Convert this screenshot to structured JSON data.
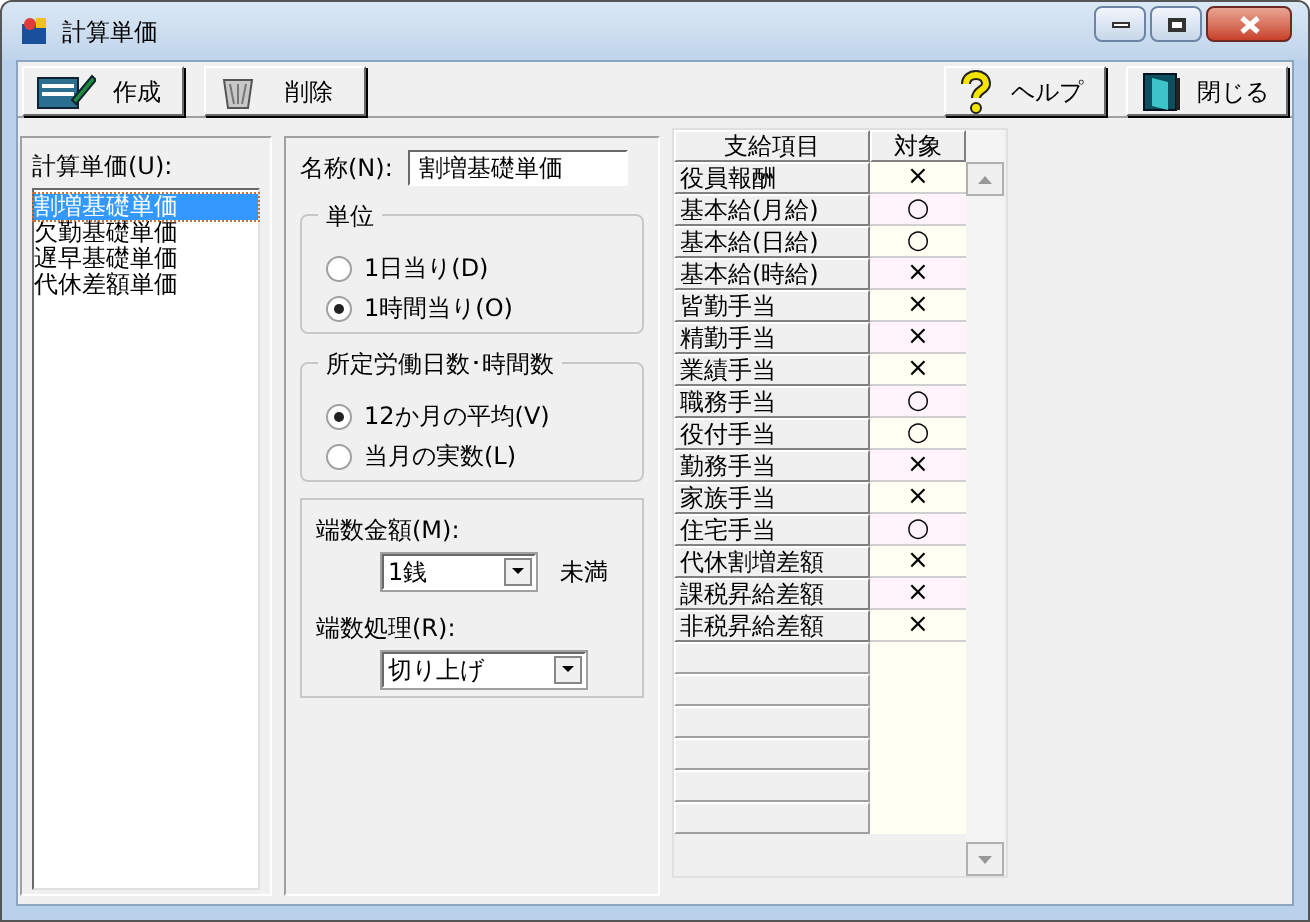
{
  "window": {
    "title": "計算単価"
  },
  "toolbar": {
    "left": [
      {
        "label": "作成",
        "kind": "create"
      },
      {
        "label": "削除",
        "kind": "delete"
      }
    ],
    "right": [
      {
        "label": "ヘルプ",
        "kind": "help"
      },
      {
        "label": "閉じる",
        "kind": "close"
      }
    ]
  },
  "unit_list": {
    "label": "計算単価(U):",
    "items": [
      {
        "label": "割増基礎単価",
        "selected": true
      },
      {
        "label": "欠勤基礎単価",
        "selected": false
      },
      {
        "label": "遅早基礎単価",
        "selected": false
      },
      {
        "label": "代休差額単価",
        "selected": false
      }
    ]
  },
  "name": {
    "label": "名称(N):",
    "value": "割増基礎単価"
  },
  "unit_group": {
    "title": "単位",
    "options": [
      {
        "label": "1日当り(D)",
        "selected": false
      },
      {
        "label": "1時間当り(O)",
        "selected": true
      }
    ]
  },
  "days_group": {
    "title": "所定労働日数･時間数",
    "options": [
      {
        "label": "12か月の平均(V)",
        "selected": true
      },
      {
        "label": "当月の実数(L)",
        "selected": false
      }
    ]
  },
  "rounding": {
    "amount_label": "端数金額(M):",
    "amount_value": "1銭",
    "amount_suffix": "未満",
    "method_label": "端数処理(R):",
    "method_value": "切り上げ"
  },
  "table": {
    "columns": [
      "支給項目",
      "対象"
    ],
    "rows": [
      {
        "item": "役員報酬",
        "target": "×"
      },
      {
        "item": "基本給(月給)",
        "target": "○"
      },
      {
        "item": "基本給(日給)",
        "target": "○"
      },
      {
        "item": "基本給(時給)",
        "target": "×"
      },
      {
        "item": "皆勤手当",
        "target": "×"
      },
      {
        "item": "精勤手当",
        "target": "×"
      },
      {
        "item": "業績手当",
        "target": "×"
      },
      {
        "item": "職務手当",
        "target": "○"
      },
      {
        "item": "役付手当",
        "target": "○"
      },
      {
        "item": "勤務手当",
        "target": "×"
      },
      {
        "item": "家族手当",
        "target": "×"
      },
      {
        "item": "住宅手当",
        "target": "○"
      },
      {
        "item": "代休割増差額",
        "target": "×"
      },
      {
        "item": "課税昇給差額",
        "target": "×"
      },
      {
        "item": "非税昇給差額",
        "target": "×"
      }
    ]
  }
}
